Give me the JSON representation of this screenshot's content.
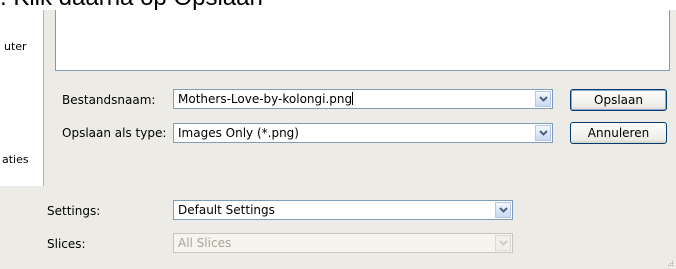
{
  "caption": {
    "text": ". Klik daarna op Opslaan"
  },
  "places": {
    "item_top": "uter",
    "item_bottom": "aties"
  },
  "save_dialog": {
    "filename_label": "Bestandsnaam:",
    "filename_value": "Mothers-Love-by-kolongi.png",
    "filetype_label": "Opslaan als type:",
    "filetype_value": "Images Only (*.png)",
    "save_button": "Opslaan",
    "cancel_button": "Annuleren"
  },
  "settings": {
    "settings_label": "Settings:",
    "settings_value": "Default Settings",
    "slices_label": "Slices:",
    "slices_value": "All Slices"
  },
  "colors": {
    "dialog_bg": "#ecebe5",
    "field_border": "#7f9db9",
    "button_border": "#003c74",
    "disabled_text": "#a7a595"
  },
  "icons": [
    "chevron-down-icon",
    "resize-grip-icon"
  ]
}
